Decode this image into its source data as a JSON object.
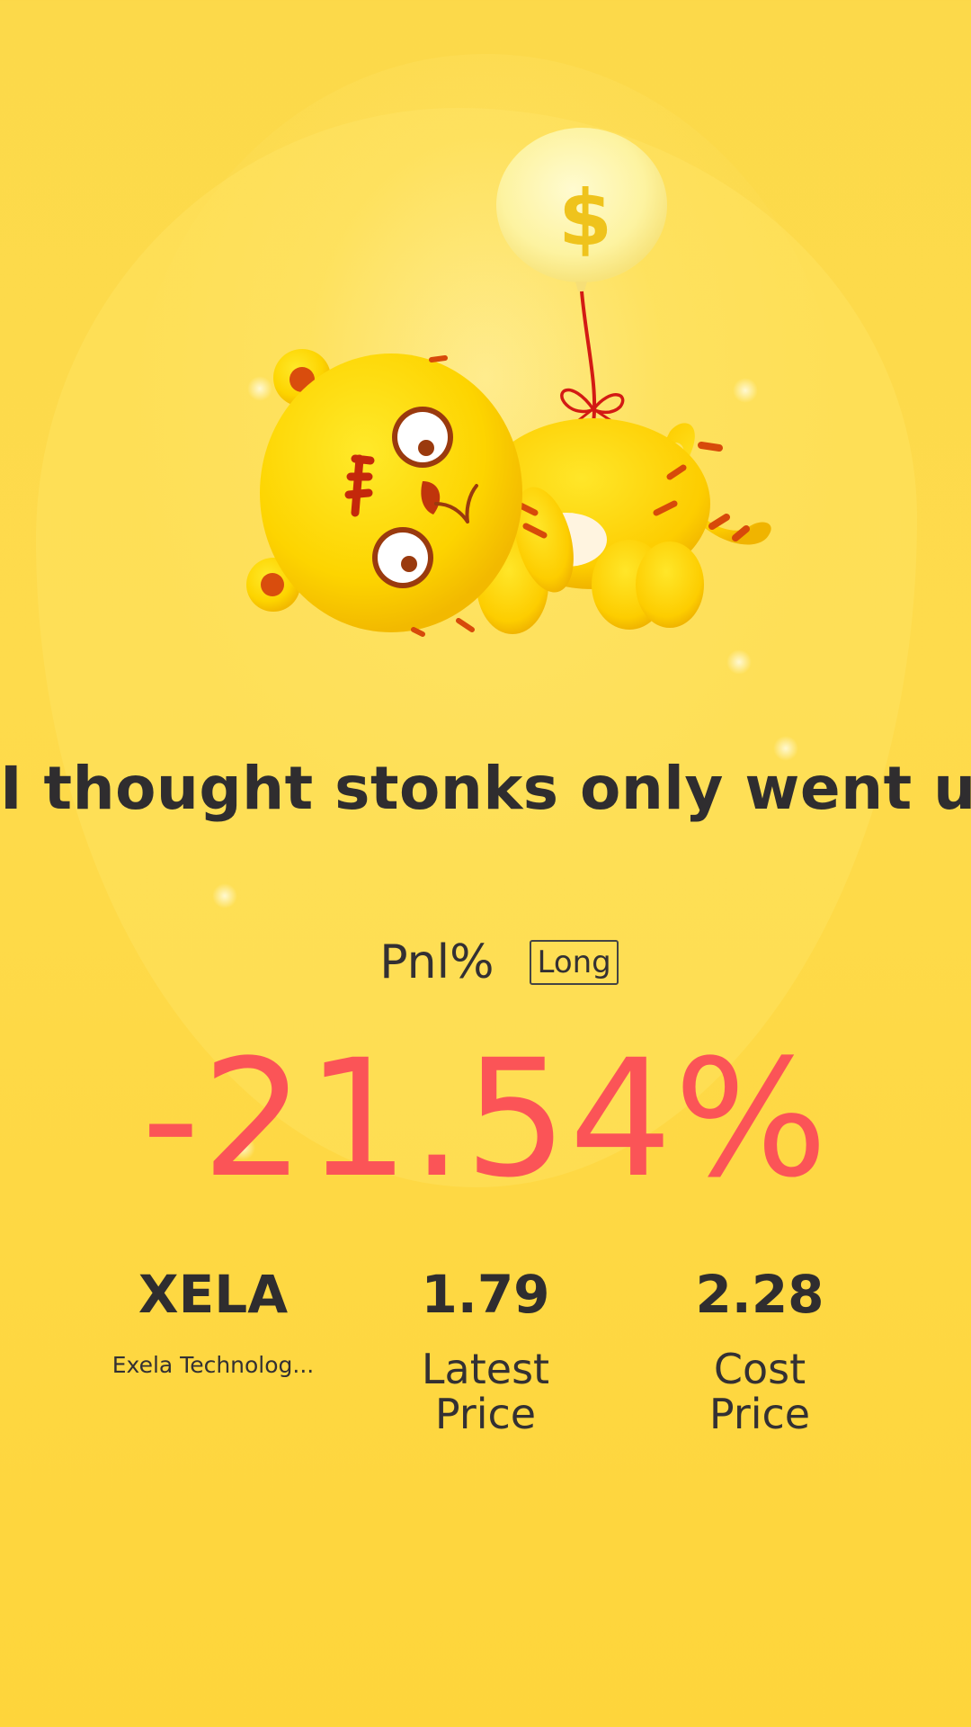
{
  "headline": "I thought stonks only went up",
  "pnl": {
    "label": "Pnl%",
    "badge": "Long",
    "value": "-21.54%"
  },
  "stock": {
    "symbol": "XELA",
    "name": "Exela Technolog..."
  },
  "latest_price": {
    "value": "1.79",
    "label": "Latest Price"
  },
  "cost_price": {
    "value": "2.28",
    "label": "Cost Price"
  },
  "illustration": {
    "balloon_symbol": "$",
    "description_icon": "tiger-with-balloon-icon"
  },
  "colors": {
    "background": "#fedb4c",
    "loss": "#fb5457",
    "text": "#2f2d2f"
  }
}
